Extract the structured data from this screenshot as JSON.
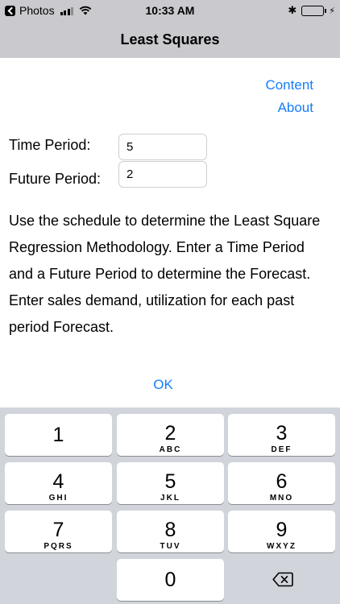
{
  "status_bar": {
    "back_app": "Photos",
    "time": "10:33 AM",
    "bluetooth": "✱",
    "battery_level": 1.0,
    "battery_color": "#4cd964"
  },
  "nav": {
    "title": "Least Squares"
  },
  "links": {
    "content": "Content",
    "about": "About"
  },
  "form": {
    "time_period_label": "Time Period:",
    "time_period_value": "5",
    "future_period_label": "Future Period:",
    "future_period_value": "2"
  },
  "description": "Use the schedule to determine the Least Square Regression Methodology. Enter a Time Period and a Future Period to determine the Forecast. Enter sales demand, utilization for each past period Forecast.",
  "ok_label": "OK",
  "accent_color": "#157efb",
  "keyboard": {
    "keys": [
      {
        "num": "1",
        "letters": ""
      },
      {
        "num": "2",
        "letters": "ABC"
      },
      {
        "num": "3",
        "letters": "DEF"
      },
      {
        "num": "4",
        "letters": "GHI"
      },
      {
        "num": "5",
        "letters": "JKL"
      },
      {
        "num": "6",
        "letters": "MNO"
      },
      {
        "num": "7",
        "letters": "PQRS"
      },
      {
        "num": "8",
        "letters": "TUV"
      },
      {
        "num": "9",
        "letters": "WXYZ"
      },
      {
        "num": "0",
        "letters": ""
      }
    ],
    "delete_icon": "backspace-icon"
  }
}
